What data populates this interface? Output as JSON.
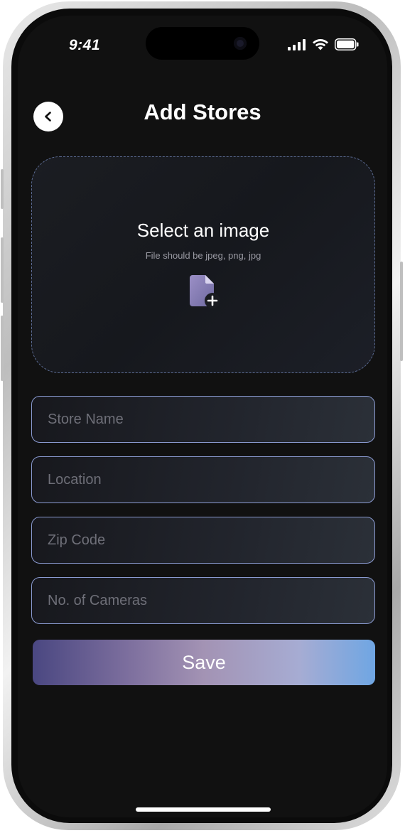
{
  "status_bar": {
    "time": "9:41"
  },
  "header": {
    "title": "Add Stores"
  },
  "upload": {
    "title": "Select an image",
    "hint": "File should be jpeg, png, jpg"
  },
  "form": {
    "store_name_placeholder": "Store Name",
    "location_placeholder": "Location",
    "zip_code_placeholder": "Zip Code",
    "cameras_placeholder": "No. of Cameras"
  },
  "actions": {
    "save_label": "Save"
  },
  "colors": {
    "background": "#111111",
    "field_border": "#8a9ad0",
    "upload_border": "#5c6c94",
    "save_gradient_start": "#4a4781",
    "save_gradient_end": "#6fa6e3"
  },
  "icons": [
    "back-chevron-icon",
    "signal-icon",
    "wifi-icon",
    "battery-icon",
    "file-add-icon"
  ]
}
